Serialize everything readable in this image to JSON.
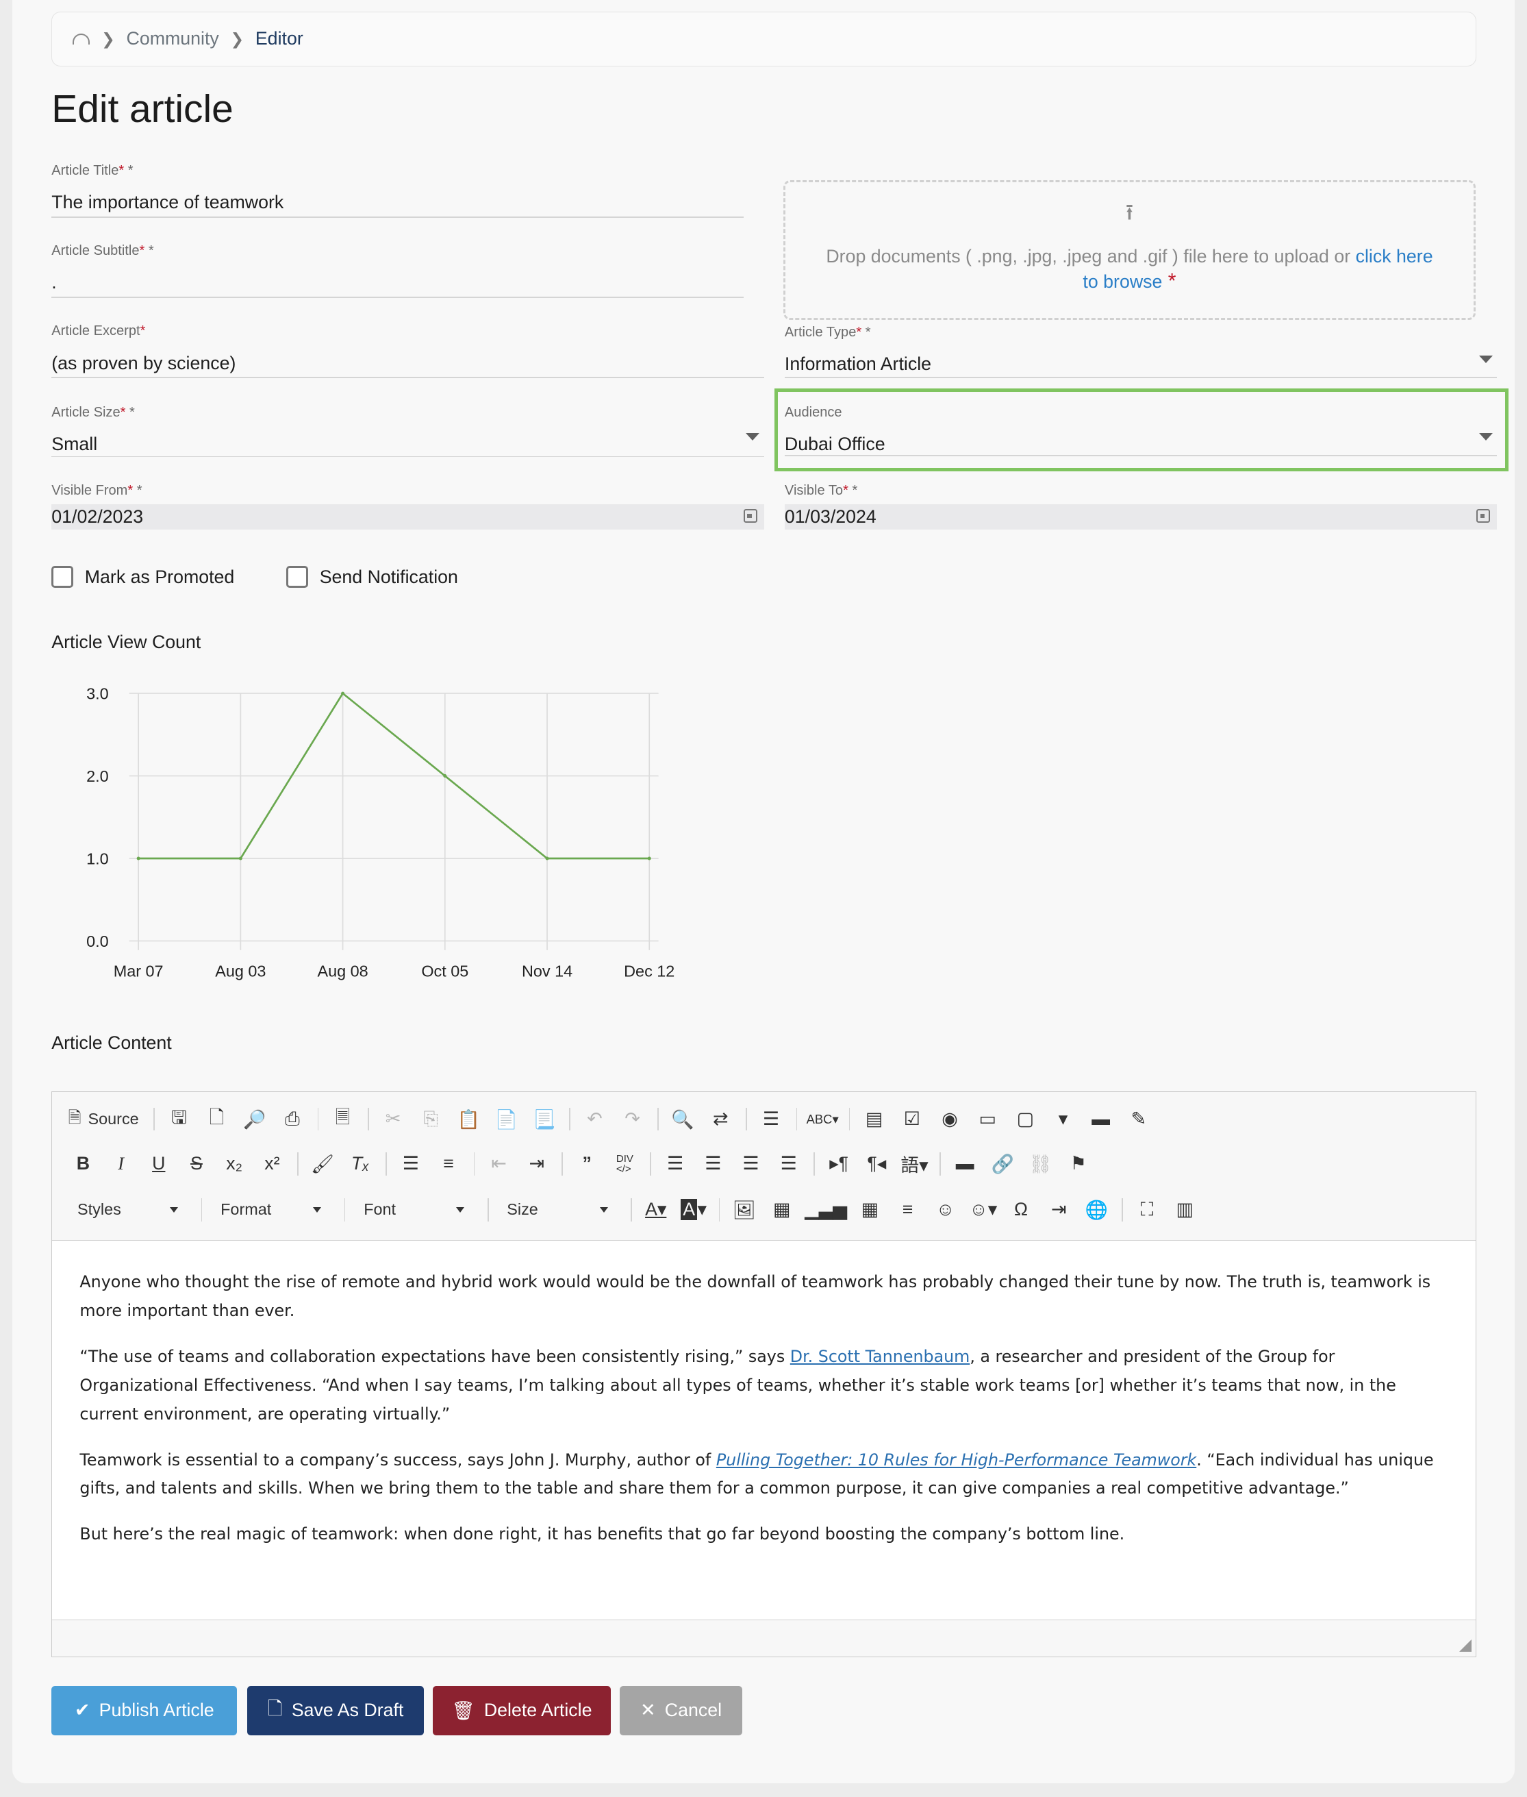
{
  "breadcrumb": {
    "home_icon": "dashboard-icon",
    "items": [
      "Community",
      "Editor"
    ]
  },
  "page_title": "Edit article",
  "fields": {
    "title": {
      "label": "Article Title",
      "value": "The importance of teamwork"
    },
    "subtitle": {
      "label": "Article Subtitle",
      "value": "."
    },
    "excerpt": {
      "label": "Article Excerpt",
      "value": "(as proven by science)"
    },
    "type": {
      "label": "Article Type",
      "value": "Information Article"
    },
    "size": {
      "label": "Article Size",
      "value": "Small"
    },
    "audience": {
      "label": "Audience",
      "value": "Dubai Office"
    },
    "visible_from": {
      "label": "Visible From",
      "value": "01/02/2023"
    },
    "visible_to": {
      "label": "Visible To",
      "value": "01/03/2024"
    }
  },
  "upload": {
    "text": "Drop documents ( .png, .jpg, .jpeg and .gif ) file here to upload or",
    "link": "click here to browse"
  },
  "checkboxes": {
    "promoted": "Mark as Promoted",
    "notify": "Send Notification"
  },
  "view_count_title": "Article View Count",
  "chart_data": {
    "type": "line",
    "categories": [
      "Mar 07",
      "Aug 03",
      "Aug 08",
      "Oct 05",
      "Nov 14",
      "Dec 12"
    ],
    "series": [
      {
        "values": [
          1,
          1,
          3,
          2,
          1,
          1
        ],
        "color": "#6aa84f"
      }
    ],
    "ylim": [
      0,
      3
    ],
    "yticks": [
      "0.0",
      "1.0",
      "2.0",
      "3.0"
    ],
    "grid": true
  },
  "content_title": "Article Content",
  "editor": {
    "source_label": "Source",
    "combos": [
      "Styles",
      "Format",
      "Font",
      "Size"
    ],
    "content": {
      "p1": "Anyone who thought the rise of remote and hybrid work would would be the downfall of teamwork has probably changed their tune by now. The truth is, teamwork is more important than ever.",
      "p2a": "“The use of teams and collaboration expectations have been consistently rising,” says ",
      "p2link": "Dr. Scott Tannenbaum",
      "p2b": ", a researcher and president of the Group for Organizational Effectiveness. “And when I say teams, I’m talking about all types of teams, whether it’s stable work teams [or] whether it’s teams that now, in the current environment, are operating virtually.”",
      "p3a": "Teamwork is essential to a company’s success, says John J. Murphy, author of ",
      "p3link": "Pulling Together: 10 Rules for High-Performance Teamwork",
      "p3b": ". “Each individual has unique gifts, and talents and skills. When we bring them to the table and share them for a common purpose, it can give companies a real competitive advantage.”",
      "p4": "But here’s the real magic of teamwork: when done right, it has benefits that go far beyond boosting the company’s bottom line."
    }
  },
  "buttons": {
    "publish": {
      "label": "Publish Article",
      "color": "#4a9fd8"
    },
    "draft": {
      "label": "Save As Draft",
      "color": "#1e3b6e"
    },
    "delete": {
      "label": "Delete Article",
      "color": "#8c2230"
    },
    "cancel": {
      "label": "Cancel",
      "color": "#a5a5a5"
    }
  },
  "colors": {
    "audience_highlight": "#80c460",
    "required": "#c0192a",
    "link": "#2a7ec7"
  }
}
